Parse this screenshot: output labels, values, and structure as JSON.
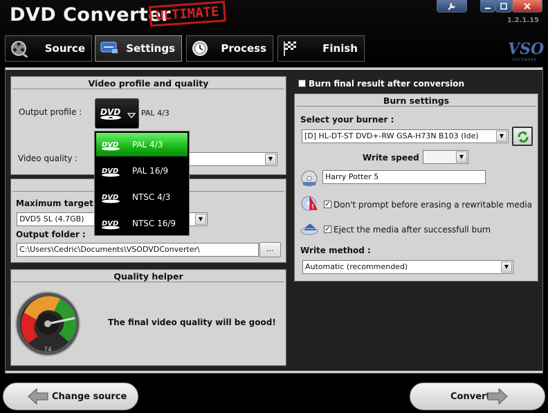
{
  "app": {
    "title": "DVD Converter",
    "edition": "ULTIMATE",
    "version": "1.2.1.15",
    "logo": "VSO",
    "logo_sub": "SOFTWARE"
  },
  "tabs": [
    {
      "label": "Source",
      "icon": "film-reel-icon",
      "active": false
    },
    {
      "label": "Settings",
      "icon": "settings-icon",
      "active": true
    },
    {
      "label": "Process",
      "icon": "clock-icon",
      "active": false
    },
    {
      "label": "Finish",
      "icon": "checkered-flag-icon",
      "active": false
    }
  ],
  "video_profile": {
    "title": "Video profile and quality",
    "output_profile_label": "Output profile :",
    "output_profile_value": "PAL 4/3",
    "video_quality_label": "Video quality :"
  },
  "profile_menu": {
    "items": [
      "PAL 4/3",
      "PAL 16/9",
      "NTSC 4/3",
      "NTSC 16/9"
    ],
    "selected_index": 0
  },
  "target": {
    "max_size_label": "Maximum target size :",
    "max_size_value": "DVD5 SL (4.7GB)",
    "output_folder_label": "Output folder :",
    "output_folder_value": "C:\\Users\\Cedric\\Documents\\VSODVDConverter\\",
    "browse_label": "..."
  },
  "quality_helper": {
    "title": "Quality helper",
    "message": "The final video quality will be good!",
    "gauge_value": 74
  },
  "burn": {
    "burn_after_label": "Burn final result after conversion",
    "burn_after_checked": false,
    "title": "Burn settings",
    "select_burner_label": "Select your burner :",
    "burner_value": "[D] HL-DT-ST DVD+-RW GSA-H73N B103 (Ide)",
    "write_speed_label": "Write speed :",
    "write_speed_value": "",
    "volume_label_value": "Harry Potter 5",
    "no_prompt_label": "Don't prompt before erasing a rewritable media",
    "no_prompt_checked": true,
    "eject_label": "Eject the media after successfull burn",
    "eject_checked": true,
    "write_method_label": "Write method :",
    "write_method_value": "Automatic (recommended)"
  },
  "bottom": {
    "back_label": "Change source",
    "next_label": "Convert"
  },
  "colors": {
    "accent_green": "#16b816",
    "stamp_red": "#d42222",
    "window_blue": "#2c4571"
  }
}
